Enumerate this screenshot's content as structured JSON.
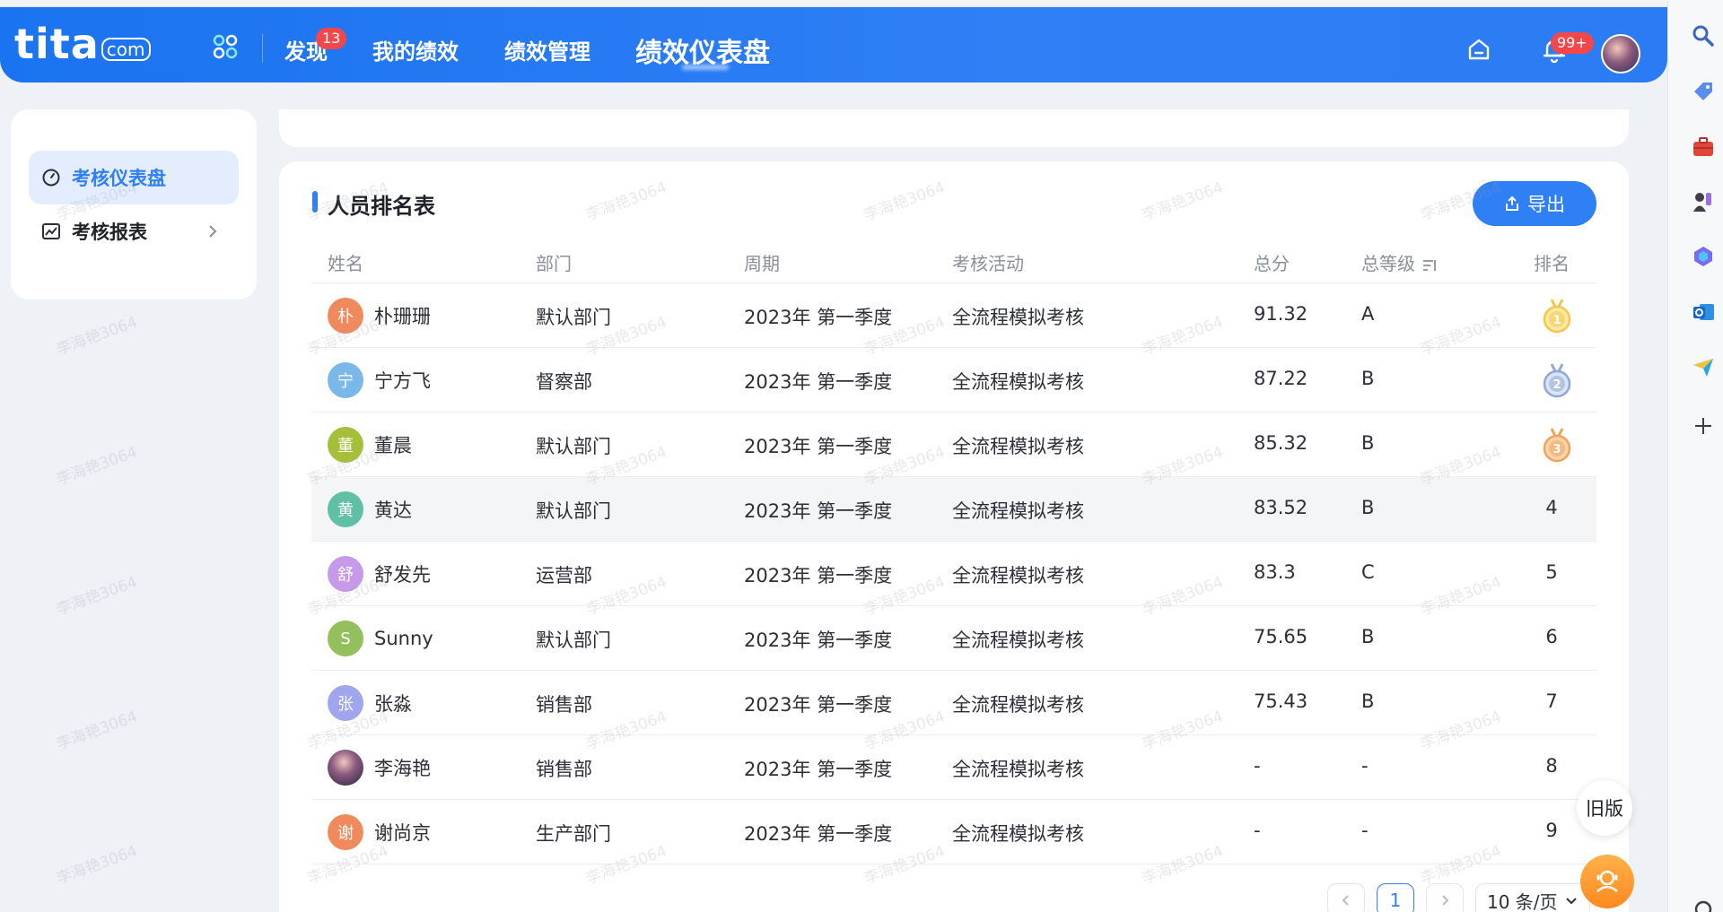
{
  "header": {
    "logo_text": "tita",
    "logo_suffix": "com",
    "nav": {
      "discover": "发现",
      "my_performance": "我的绩效",
      "performance_management": "绩效管理",
      "dashboard": "绩效仪表盘"
    },
    "discover_badge": "13",
    "notification_badge": "99+"
  },
  "sidebar": {
    "items": [
      {
        "label": "考核仪表盘",
        "active": true
      },
      {
        "label": "考核报表",
        "active": false
      }
    ]
  },
  "ranking": {
    "title": "人员排名表",
    "export_label": "导出",
    "columns": {
      "name": "姓名",
      "dept": "部门",
      "cycle": "周期",
      "activity": "考核活动",
      "score": "总分",
      "grade": "总等级",
      "rank": "排名"
    },
    "rows": [
      {
        "avatar": "朴",
        "avatar_color": "#f08a5d",
        "name": "朴珊珊",
        "dept": "默认部门",
        "cycle": "2023年 第一季度",
        "activity": "全流程模拟考核",
        "score": "91.32",
        "grade": "A",
        "rank": "1",
        "medal": "gold"
      },
      {
        "avatar": "宁",
        "avatar_color": "#7bb8ea",
        "name": "宁方飞",
        "dept": "督察部",
        "cycle": "2023年 第一季度",
        "activity": "全流程模拟考核",
        "score": "87.22",
        "grade": "B",
        "rank": "2",
        "medal": "silver"
      },
      {
        "avatar": "董",
        "avatar_color": "#a6bf3a",
        "name": "董晨",
        "dept": "默认部门",
        "cycle": "2023年 第一季度",
        "activity": "全流程模拟考核",
        "score": "85.32",
        "grade": "B",
        "rank": "3",
        "medal": "bronze"
      },
      {
        "avatar": "黄",
        "avatar_color": "#5fc0a5",
        "name": "黄达",
        "dept": "默认部门",
        "cycle": "2023年 第一季度",
        "activity": "全流程模拟考核",
        "score": "83.52",
        "grade": "B",
        "rank": "4"
      },
      {
        "avatar": "舒",
        "avatar_color": "#c69ae8",
        "name": "舒发先",
        "dept": "运营部",
        "cycle": "2023年 第一季度",
        "activity": "全流程模拟考核",
        "score": "83.3",
        "grade": "C",
        "rank": "5"
      },
      {
        "avatar": "S",
        "avatar_color": "#93c05c",
        "name": "Sunny",
        "dept": "默认部门",
        "cycle": "2023年 第一季度",
        "activity": "全流程模拟考核",
        "score": "75.65",
        "grade": "B",
        "rank": "6"
      },
      {
        "avatar": "张",
        "avatar_color": "#9fa6ee",
        "name": "张淼",
        "dept": "销售部",
        "cycle": "2023年 第一季度",
        "activity": "全流程模拟考核",
        "score": "75.43",
        "grade": "B",
        "rank": "7"
      },
      {
        "avatar": "",
        "avatar_color": "",
        "name": "李海艳",
        "dept": "销售部",
        "cycle": "2023年 第一季度",
        "activity": "全流程模拟考核",
        "score": "-",
        "grade": "-",
        "rank": "8",
        "photo": true
      },
      {
        "avatar": "谢",
        "avatar_color": "#f08a5d",
        "name": "谢尚京",
        "dept": "生产部门",
        "cycle": "2023年 第一季度",
        "activity": "全流程模拟考核",
        "score": "-",
        "grade": "-",
        "rank": "9"
      }
    ]
  },
  "pagination": {
    "current_page": "1",
    "page_size": "10 条/页"
  },
  "float": {
    "old_version": "旧版"
  },
  "watermark": "李海艳3064",
  "colors": {
    "primary": "#2f7ff5",
    "badge": "#f5474a",
    "gold": "#f6c64a",
    "silver": "#8fa8d6",
    "bronze": "#f2a35a"
  }
}
